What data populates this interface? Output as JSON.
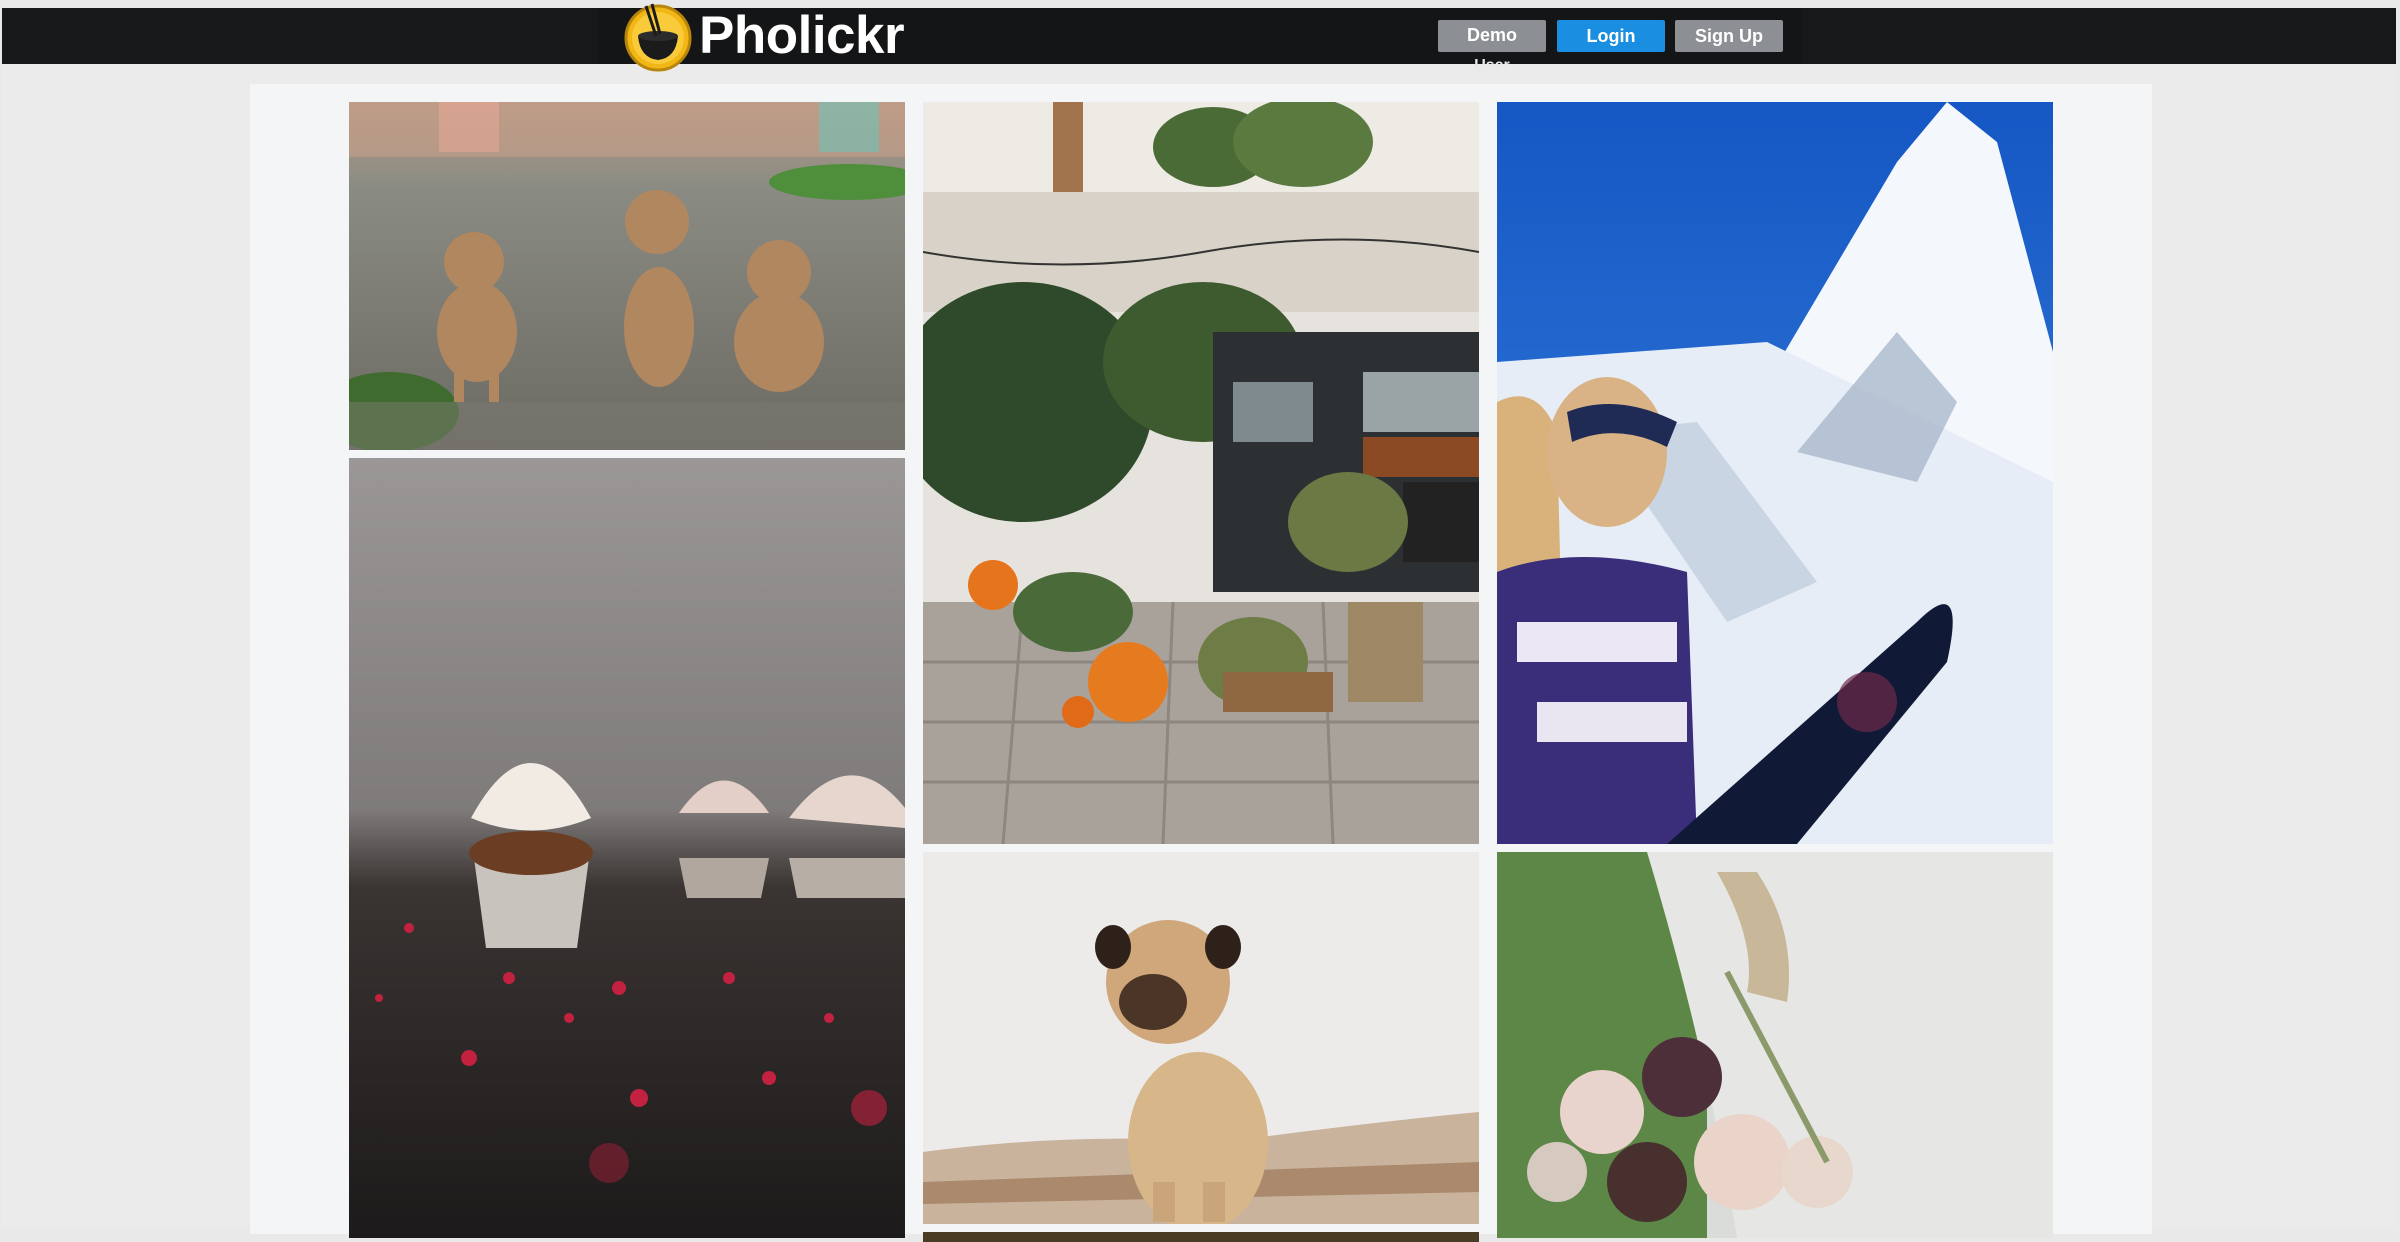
{
  "header": {
    "brand": "Pholickr",
    "buttons": {
      "demo_line1": "Demo",
      "demo_line2": "User",
      "login": "Login",
      "signup": "Sign Up"
    }
  },
  "gallery": {
    "photos": [
      {
        "subject": "three puppies on gravel road"
      },
      {
        "subject": "food truck with plants and pumpkins"
      },
      {
        "subject": "snowboarder looking at mountain"
      },
      {
        "subject": "cupcakes with red sprinkles"
      },
      {
        "subject": "pug sitting on blanket"
      },
      {
        "subject": "bridal bouquet of roses"
      },
      {
        "subject": "partial photo"
      }
    ]
  },
  "colors": {
    "topbar": "#17181a",
    "login_button": "#1a8ee0",
    "secondary_button": "#8c8f94",
    "content_background": "#f4f5f7"
  }
}
